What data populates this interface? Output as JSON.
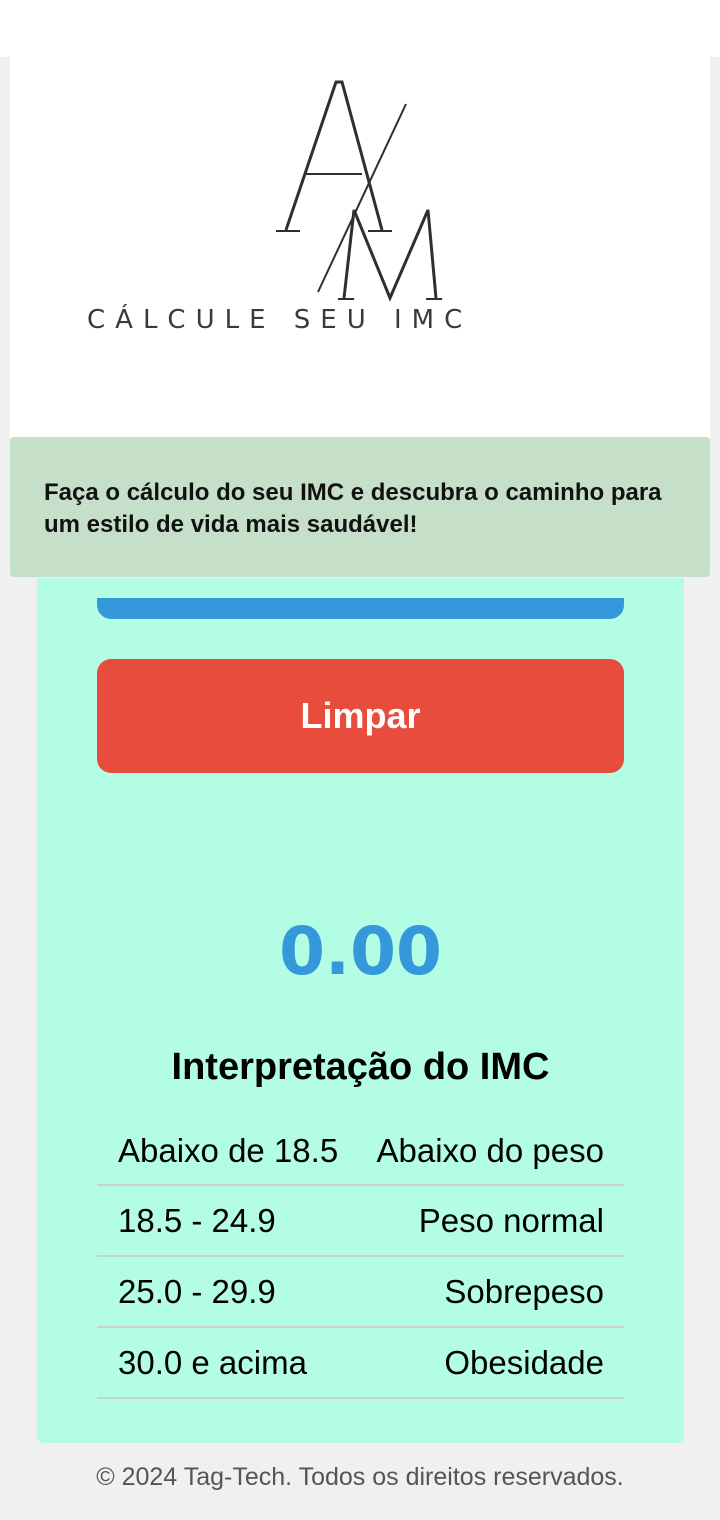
{
  "header": {
    "logo_text": "CÁLCULE SEU IMC"
  },
  "banner": {
    "text": "Faça o cálculo do seu IMC e descubra o caminho para um estilo de vida mais saudável!"
  },
  "calculator": {
    "clear_button_label": "Limpar",
    "imc_value": "0.00",
    "interpretation_title": "Interpretação do IMC",
    "rows": [
      {
        "range": "Abaixo de 18.5",
        "label": "Abaixo do peso"
      },
      {
        "range": "18.5 - 24.9",
        "label": "Peso normal"
      },
      {
        "range": "25.0 - 29.9",
        "label": "Sobrepeso"
      },
      {
        "range": "30.0 e acima",
        "label": "Obesidade"
      }
    ]
  },
  "footer": {
    "text": "© 2024 Tag-Tech. Todos os direitos reservados."
  },
  "colors": {
    "accent_blue": "#3498db",
    "clear_red": "#e74c3c",
    "card_bg": "#b4fde5",
    "banner_bg": "#c6dfc8"
  }
}
